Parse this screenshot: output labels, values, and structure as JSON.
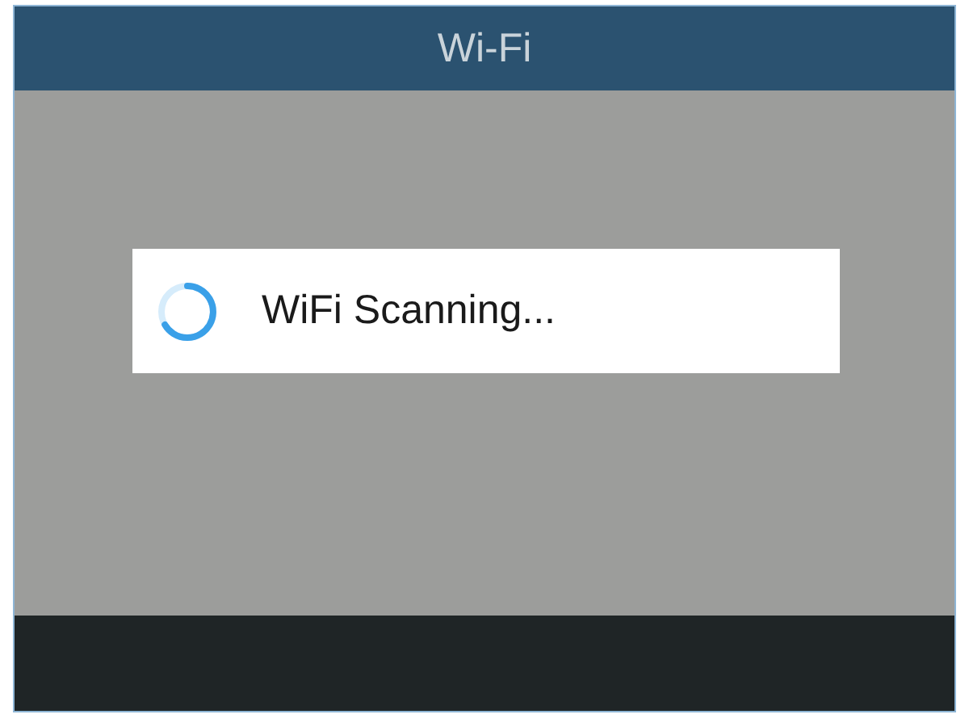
{
  "window": {
    "title": "Wi-Fi"
  },
  "dialog": {
    "message": "WiFi Scanning..."
  }
}
